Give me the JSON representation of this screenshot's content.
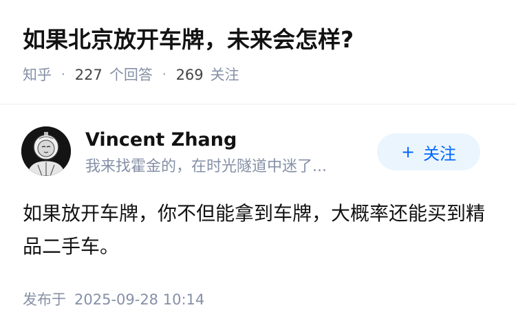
{
  "question": {
    "title": "如果北京放开车牌，未来会怎样?",
    "source": "知乎",
    "answer_count": "227",
    "answer_label": "个回答",
    "follower_count": "269",
    "follower_label": "关注"
  },
  "answer": {
    "author_name": "Vincent Zhang",
    "author_bio": "我来找霍金的，在时光隧道中迷了...",
    "follow_button_label": "关注",
    "follow_icon": "plus-icon",
    "content": "如果放开车牌，你不但能拿到车牌，大概率还能买到精品二手车。",
    "published_label": "发布于",
    "published_time": "2025-09-28 10:14"
  },
  "colors": {
    "accent": "#0066ff",
    "follow_bg": "#ebf5fd",
    "meta_gray": "#8590a6",
    "text": "#121212"
  }
}
